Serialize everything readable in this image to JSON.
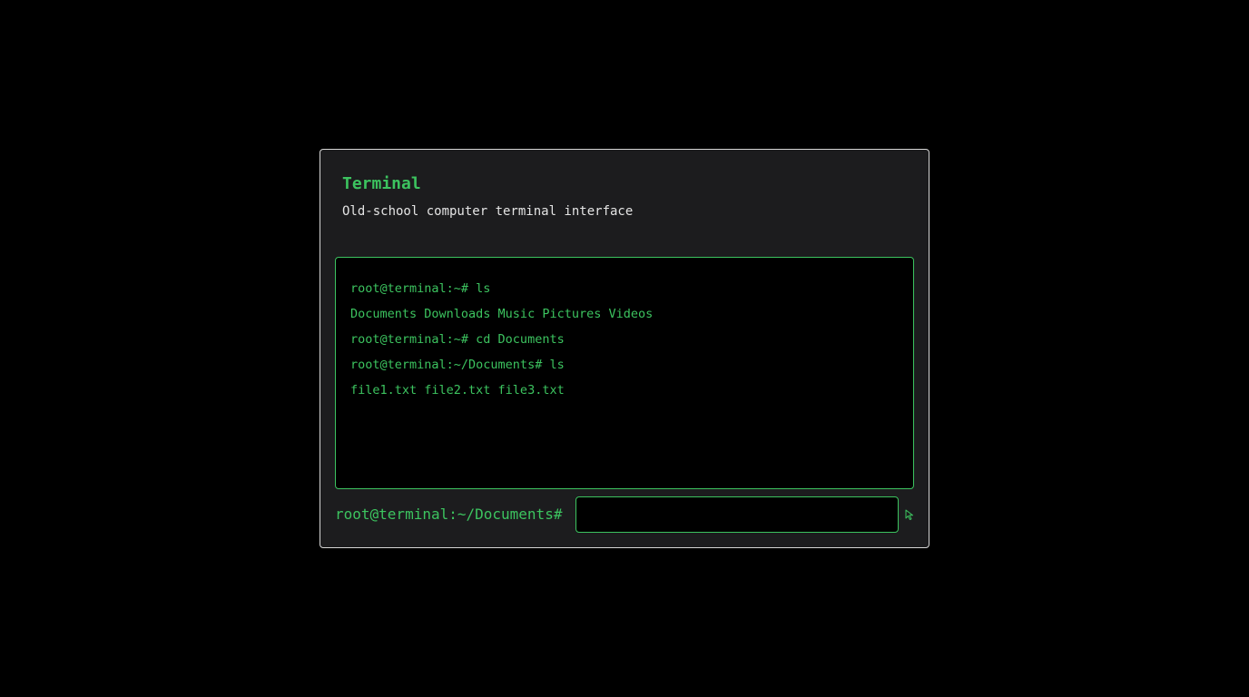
{
  "header": {
    "title": "Terminal",
    "subtitle": "Old-school computer terminal interface"
  },
  "terminal": {
    "lines": [
      "root@terminal:~# ls",
      "Documents Downloads Music Pictures Videos",
      "root@terminal:~# cd Documents",
      "root@terminal:~/Documents# ls",
      "file1.txt file2.txt file3.txt"
    ]
  },
  "prompt": {
    "label": "root@terminal:~/Documents#",
    "input_value": "",
    "submit_icon": "cursor-arrow-icon"
  },
  "colors": {
    "background": "#000000",
    "card": "#1c1c1e",
    "accent": "#3cc35f",
    "text": "#e4e4e4"
  }
}
